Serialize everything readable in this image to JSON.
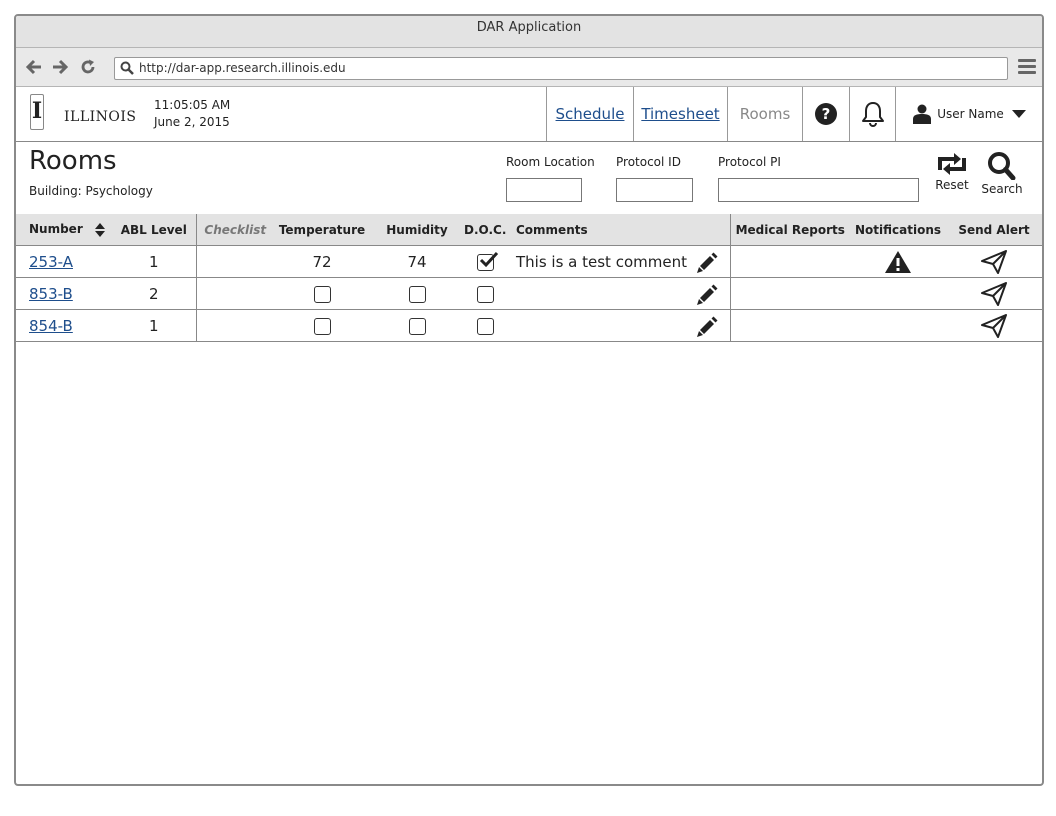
{
  "window": {
    "title": "DAR Application"
  },
  "browser": {
    "url": "http://dar-app.research.illinois.edu"
  },
  "header": {
    "logo_letter": "I",
    "logo_text": "ILLINOIS",
    "time": "11:05:05 AM",
    "date": "June 2, 2015",
    "nav": [
      {
        "label": "Schedule",
        "active": false
      },
      {
        "label": "Timesheet",
        "active": false
      },
      {
        "label": "Rooms",
        "active": true
      }
    ],
    "user_name": "User Name"
  },
  "page": {
    "title": "Rooms",
    "building": "Building: Psychology",
    "filters": {
      "room_location_label": "Room Location",
      "protocol_id_label": "Protocol ID",
      "protocol_pi_label": "Protocol PI",
      "room_location_value": "",
      "protocol_id_value": "",
      "protocol_pi_value": ""
    },
    "reset_label": "Reset",
    "search_label": "Search"
  },
  "table": {
    "columns": [
      "Number",
      "ABL Level",
      "Checklist",
      "Temperature",
      "Humidity",
      "D.O.C.",
      "Comments",
      "Medical Reports",
      "Notifications",
      "Send Alert"
    ],
    "rows": [
      {
        "number": "253-A",
        "abl_level": "1",
        "temperature": "72",
        "humidity": "74",
        "doc_checked": true,
        "comment": "This is a test comment",
        "notification": "warning-icon"
      },
      {
        "number": "853-B",
        "abl_level": "2",
        "temperature": "",
        "humidity": "",
        "doc_checked": false,
        "comment": "",
        "notification": ""
      },
      {
        "number": "854-B",
        "abl_level": "1",
        "temperature": "",
        "humidity": "",
        "doc_checked": false,
        "comment": "",
        "notification": ""
      }
    ]
  },
  "colors": {
    "link": "#1e4e8c",
    "header_bg": "#e3e3e3",
    "border": "#888888"
  }
}
